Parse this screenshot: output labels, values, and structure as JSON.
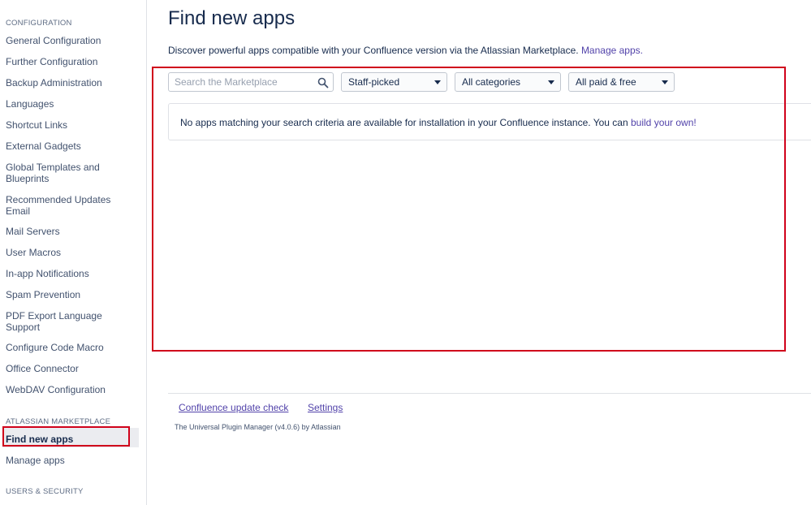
{
  "sidebar": {
    "sections": {
      "configuration": "CONFIGURATION",
      "marketplace": "ATLASSIAN MARKETPLACE",
      "users_security": "USERS & SECURITY"
    },
    "config_items": [
      "General Configuration",
      "Further Configuration",
      "Backup Administration",
      "Languages",
      "Shortcut Links",
      "External Gadgets",
      "Global Templates and Blueprints",
      "Recommended Updates Email",
      "Mail Servers",
      "User Macros",
      "In-app Notifications",
      "Spam Prevention",
      "PDF Export Language Support",
      "Configure Code Macro",
      "Office Connector",
      "WebDAV Configuration"
    ],
    "marketplace_items": [
      "Find new apps",
      "Manage apps"
    ],
    "active_item": "Find new apps"
  },
  "main": {
    "title": "Find new apps",
    "description": "Discover powerful apps compatible with your Confluence version via the Atlassian Marketplace.",
    "manage_link": "Manage apps.",
    "search": {
      "placeholder": "Search the Marketplace",
      "icon": "search-icon"
    },
    "filters": {
      "sort": "Staff-picked",
      "category": "All categories",
      "pricing": "All paid & free"
    },
    "message": {
      "text": "No apps matching your search criteria are available for installation in your Confluence instance. You can",
      "link": "build your own!"
    }
  },
  "footer": {
    "links": [
      "Confluence update check",
      "Settings"
    ],
    "note": "The Universal Plugin Manager (v4.0.6) by Atlassian"
  },
  "colors": {
    "highlight": "#d0021b",
    "link": "#5243aa",
    "text": "#172b4d"
  }
}
